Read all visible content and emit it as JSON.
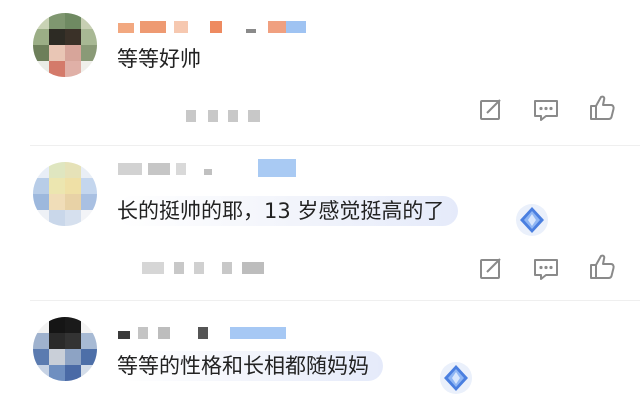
{
  "comments": [
    {
      "text": "等等好帅",
      "badge": false,
      "actions": [
        {
          "icon": "edit-icon"
        },
        {
          "icon": "reply-icon"
        },
        {
          "icon": "like-icon"
        }
      ]
    },
    {
      "text": "长的挺帅的耶，13 岁感觉挺高的了",
      "badge": true,
      "actions": [
        {
          "icon": "edit-icon"
        },
        {
          "icon": "reply-icon"
        },
        {
          "icon": "like-icon"
        }
      ]
    },
    {
      "text": "等等的性格和长相都随妈妈",
      "badge": true,
      "actions": []
    }
  ],
  "colors": {
    "text": "#222222",
    "icon": "#8a8a8a",
    "blur_gray": "#c8c8c8",
    "badge_blue": "#4a7fe0"
  }
}
